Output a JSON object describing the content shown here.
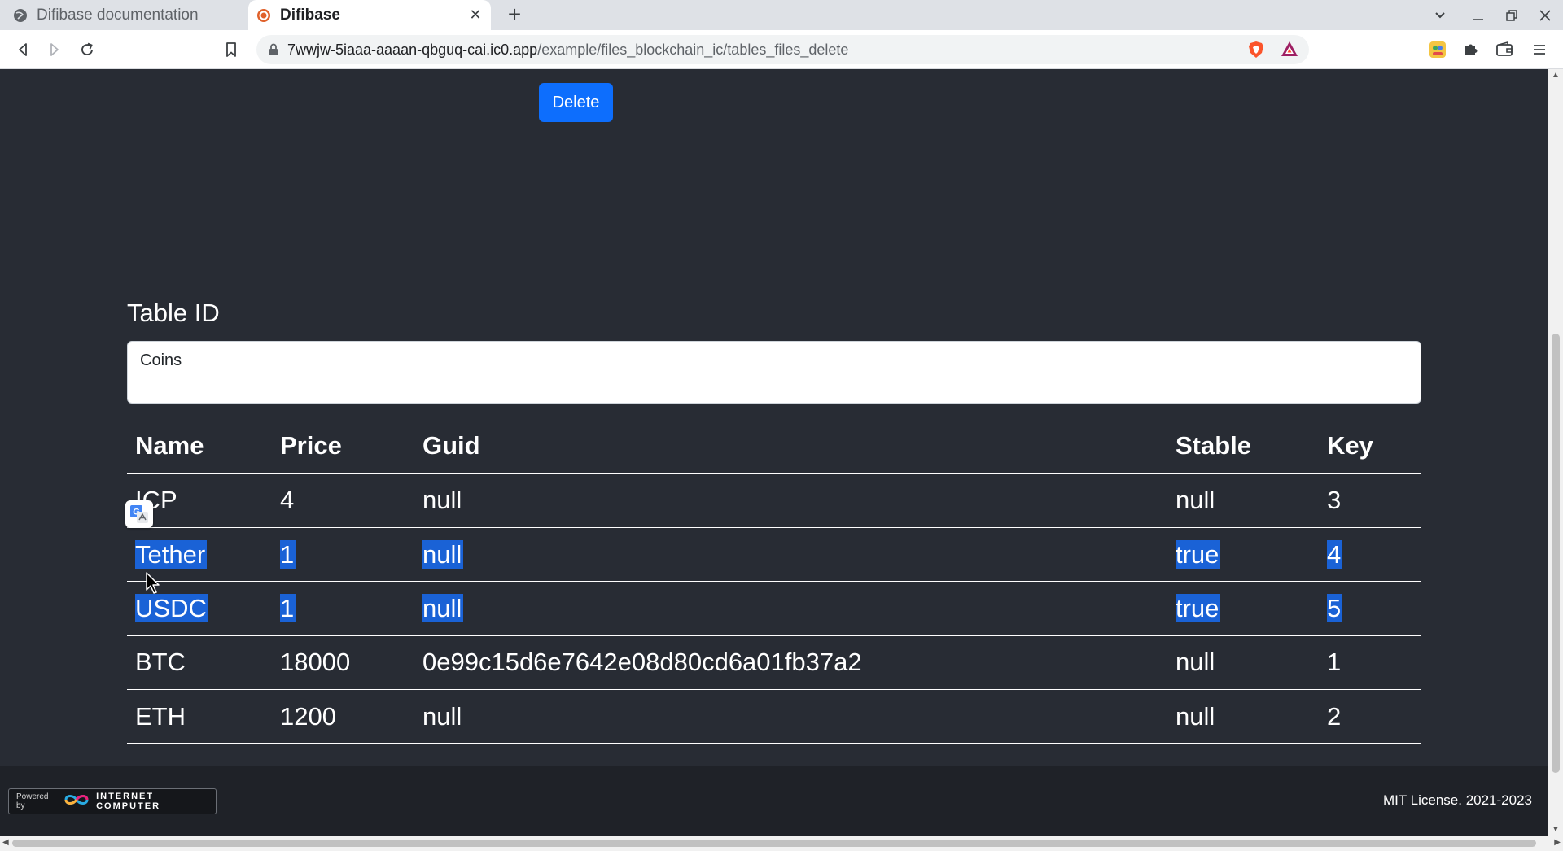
{
  "browser": {
    "tabs": [
      {
        "title": "Difibase documentation",
        "active": false
      },
      {
        "title": "Difibase",
        "active": true
      }
    ],
    "url_host": "7wwjw-5iaaa-aaaan-qbguq-cai.ic0.app",
    "url_path": "/example/files_blockchain_ic/tables_files_delete"
  },
  "page": {
    "delete_button": "Delete",
    "table_id_label": "Table ID",
    "table_id_value": "Coins"
  },
  "table": {
    "headers": [
      "Name",
      "Price",
      "Guid",
      "Stable",
      "Key"
    ],
    "rows": [
      {
        "name": "ICP",
        "price": "4",
        "guid": "null",
        "stable": "null",
        "key": "3",
        "selected": false
      },
      {
        "name": "Tether",
        "price": "1",
        "guid": "null",
        "stable": "true",
        "key": "4",
        "selected": true
      },
      {
        "name": "USDC",
        "price": "1",
        "guid": "null",
        "stable": "true",
        "key": "5",
        "selected": true
      },
      {
        "name": "BTC",
        "price": "18000",
        "guid": "0e99c15d6e7642e08d80cd6a01fb37a2",
        "stable": "null",
        "key": "1",
        "selected": false
      },
      {
        "name": "ETH",
        "price": "1200",
        "guid": "null",
        "stable": "null",
        "key": "2",
        "selected": false
      }
    ]
  },
  "footer": {
    "powered_by": "Powered by",
    "ic_name": "INTERNET COMPUTER",
    "license": "MIT License. 2021-2023"
  },
  "colors": {
    "page_background": "#282c34",
    "primary_button": "#0d6efd",
    "selection_highlight": "#1a62d6"
  }
}
